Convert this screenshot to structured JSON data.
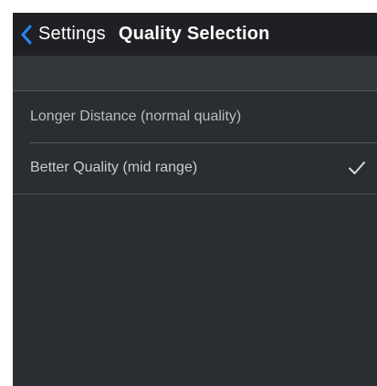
{
  "navbar": {
    "back_label": "Settings",
    "title": "Quality Selection",
    "back_icon": "chevron-left-icon"
  },
  "quality_options": [
    {
      "label": "Longer Distance (normal quality)",
      "selected": false
    },
    {
      "label": "Better Quality (mid range)",
      "selected": true
    }
  ],
  "colors": {
    "accent": "#1e8bff",
    "background": "#2a2d31",
    "navbar": "#1e2023"
  }
}
